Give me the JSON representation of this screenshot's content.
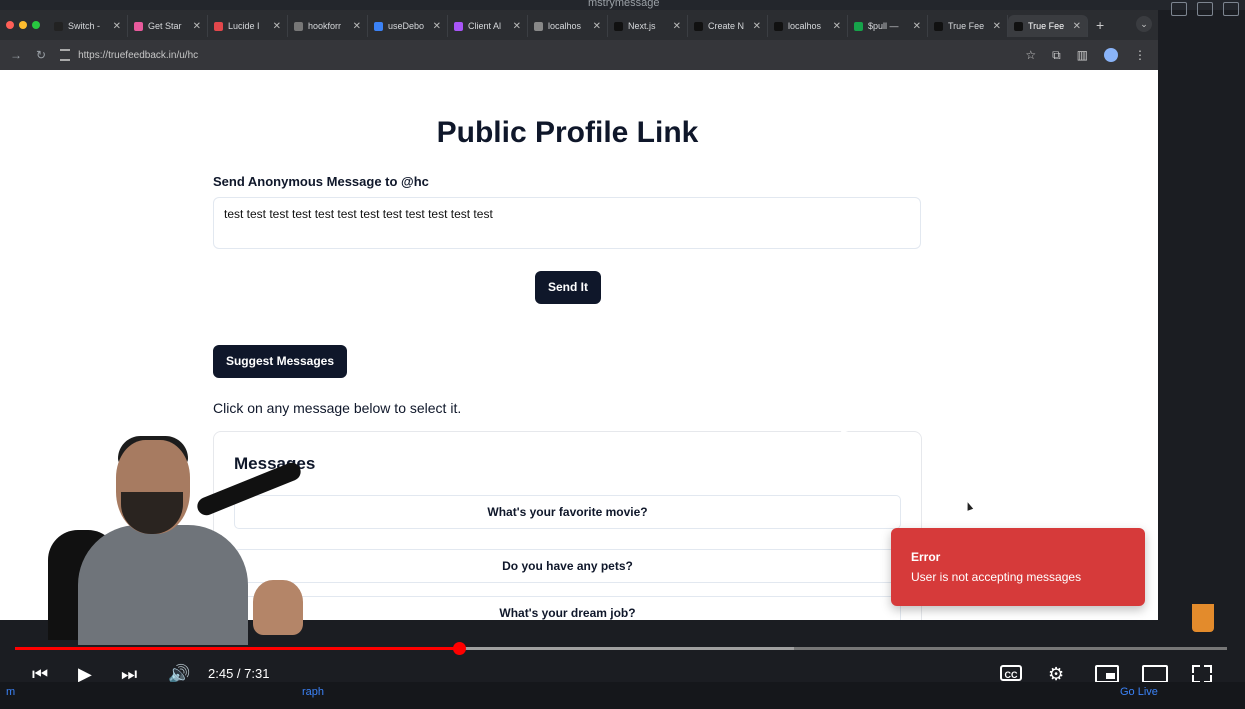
{
  "window": {
    "title": "mstrymessage"
  },
  "browser": {
    "tabs": [
      {
        "label": "Switch -",
        "fav": "#222"
      },
      {
        "label": "Get Star",
        "fav": "#e85a9c"
      },
      {
        "label": "Lucide I",
        "fav": "#e2474b"
      },
      {
        "label": "hookforr",
        "fav": "#777"
      },
      {
        "label": "useDebo",
        "fav": "#3b82f6"
      },
      {
        "label": "Client Al",
        "fav": "#a855f7"
      },
      {
        "label": "localhos",
        "fav": "#888"
      },
      {
        "label": "Next.js",
        "fav": "#111"
      },
      {
        "label": "Create N",
        "fav": "#111"
      },
      {
        "label": "localhos",
        "fav": "#111"
      },
      {
        "label": "$pull —",
        "fav": "#16a34a"
      },
      {
        "label": "True Fee",
        "fav": "#111"
      },
      {
        "label": "True Fee",
        "fav": "#111",
        "active": true
      }
    ],
    "url": "https://truefeedback.in/u/hc"
  },
  "page": {
    "title": "Public Profile Link",
    "field_label": "Send Anonymous Message to @hc",
    "message_value": "test test test test test test test test test test test test",
    "send_label": "Send It",
    "suggest_label": "Suggest Messages",
    "hint": "Click on any message below to select it.",
    "messages_title": "Messages",
    "messages": [
      "What's your favorite movie?",
      "Do you have any pets?",
      "What's your dream job?"
    ]
  },
  "toast": {
    "title": "Error",
    "description": "User is not accepting messages",
    "color": "#d63a3a"
  },
  "video": {
    "time": "2:45 / 7:31",
    "progress": 0.366,
    "buffered": 0.643,
    "cc_label": "CC"
  },
  "statusbar": {
    "left": "m",
    "mid": "raph",
    "go_live": "Go Live"
  }
}
